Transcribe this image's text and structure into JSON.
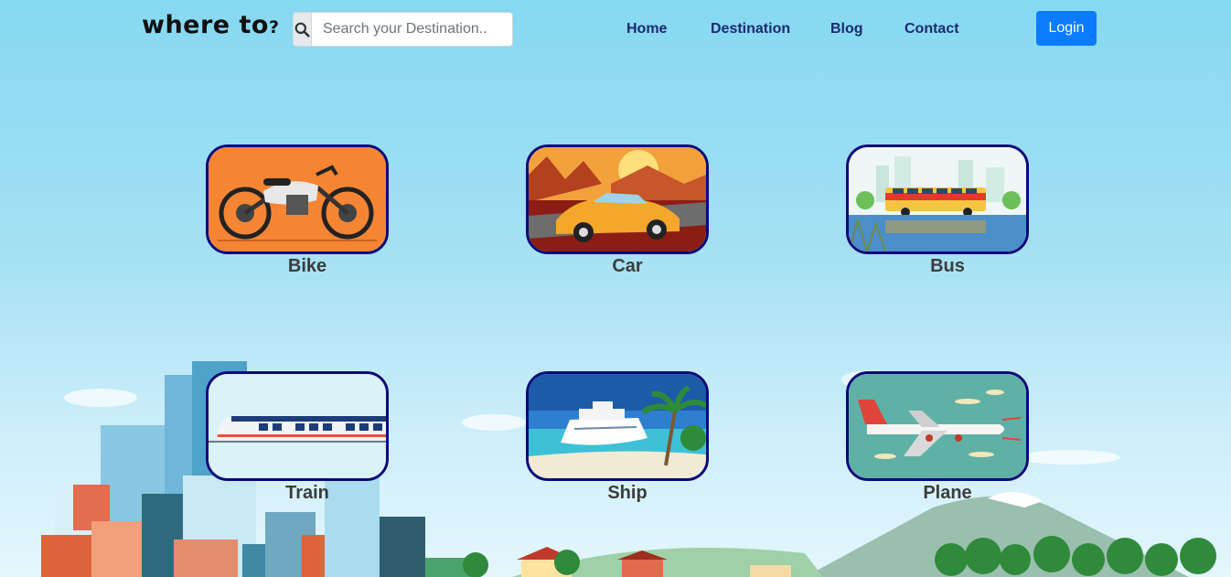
{
  "brand": {
    "logo_text": "where to",
    "logo_mark": "?"
  },
  "search": {
    "placeholder": "Search your Destination..",
    "icon": "search-icon"
  },
  "nav": {
    "items": [
      {
        "label": "Home"
      },
      {
        "label": "Destination"
      },
      {
        "label": "Blog"
      },
      {
        "label": "Contact"
      }
    ],
    "login_label": "Login"
  },
  "transport": [
    {
      "label": "Bike",
      "icon": "motorcycle-image"
    },
    {
      "label": "Car",
      "icon": "car-image"
    },
    {
      "label": "Bus",
      "icon": "bus-image"
    },
    {
      "label": "Train",
      "icon": "train-image"
    },
    {
      "label": "Ship",
      "icon": "ship-image"
    },
    {
      "label": "Plane",
      "icon": "plane-image"
    }
  ],
  "colors": {
    "accent": "#0d7bff",
    "nav_text": "#1a2a72",
    "card_border": "#0a0a7a",
    "sky_top": "#86d8f2"
  }
}
